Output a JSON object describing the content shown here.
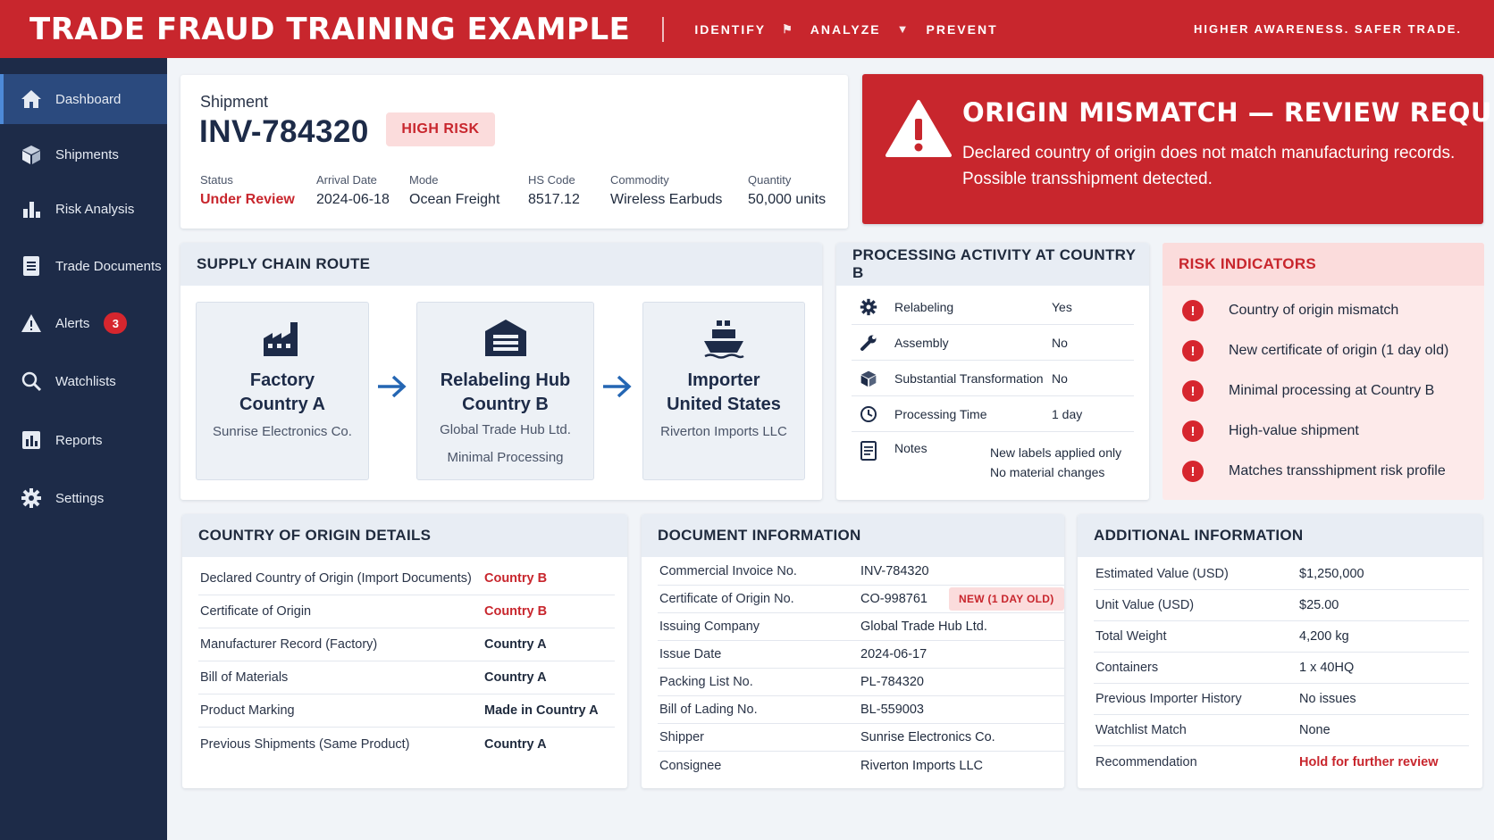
{
  "header": {
    "title": "TRADE FRAUD TRAINING EXAMPLE",
    "steps": [
      "IDENTIFY",
      "ANALYZE",
      "PREVENT"
    ],
    "tagline": "HIGHER AWARENESS. SAFER TRADE."
  },
  "sidebar": {
    "items": [
      {
        "label": "Dashboard",
        "icon": "home-icon",
        "active": true
      },
      {
        "label": "Shipments",
        "icon": "box-icon"
      },
      {
        "label": "Risk Analysis",
        "icon": "bar-chart-icon"
      },
      {
        "label": "Trade Documents",
        "icon": "document-icon"
      },
      {
        "label": "Alerts",
        "icon": "warning-icon",
        "badge": "3"
      },
      {
        "label": "Watchlists",
        "icon": "search-icon"
      },
      {
        "label": "Reports",
        "icon": "report-icon"
      },
      {
        "label": "Settings",
        "icon": "gear-icon"
      }
    ]
  },
  "shipment": {
    "label": "Shipment",
    "id": "INV-784320",
    "risk": "HIGH RISK",
    "fields": [
      {
        "key": "Status",
        "value": "Under Review"
      },
      {
        "key": "Arrival Date",
        "value": "2024-06-18"
      },
      {
        "key": "Mode",
        "value": "Ocean Freight"
      },
      {
        "key": "HS Code",
        "value": "8517.12"
      },
      {
        "key": "Commodity",
        "value": "Wireless Earbuds"
      },
      {
        "key": "Quantity",
        "value": "50,000 units"
      }
    ]
  },
  "alert": {
    "title": "ORIGIN MISMATCH — REVIEW REQUIRED",
    "body": "Declared country of origin does not match manufacturing records. Possible transshipment detected."
  },
  "route": {
    "title": "SUPPLY CHAIN ROUTE",
    "nodes": [
      {
        "title1": "Factory",
        "title2": "Country A",
        "sub1": "Sunrise Electronics Co.",
        "sub2": ""
      },
      {
        "title1": "Relabeling Hub",
        "title2": "Country B",
        "sub1": "Global Trade Hub Ltd.",
        "sub2": "Minimal Processing"
      },
      {
        "title1": "Importer",
        "title2": "United States",
        "sub1": "Riverton Imports LLC",
        "sub2": ""
      }
    ]
  },
  "processing": {
    "title": "PROCESSING ACTIVITY AT COUNTRY B",
    "rows": [
      {
        "icon": "gear-icon",
        "key": "Relabeling",
        "value": "Yes"
      },
      {
        "icon": "wrench-icon",
        "key": "Assembly",
        "value": "No"
      },
      {
        "icon": "cube-icon",
        "key": "Substantial Transformation",
        "value": "No"
      },
      {
        "icon": "clock-icon",
        "key": "Processing Time",
        "value": "1 day"
      },
      {
        "icon": "notes-icon",
        "key": "Notes",
        "value1": "New labels applied only",
        "value2": "No material changes"
      }
    ]
  },
  "risk_indicators": {
    "title": "RISK INDICATORS",
    "items": [
      "Country of origin mismatch",
      "New certificate of origin (1 day old)",
      "Minimal processing at Country B",
      "High-value shipment",
      "Matches transshipment risk profile"
    ]
  },
  "origin": {
    "title": "COUNTRY OF ORIGIN DETAILS",
    "rows": [
      {
        "key": "Declared Country of Origin (Import Documents)",
        "value": "Country B"
      },
      {
        "key": "Certificate of Origin",
        "value": "Country B"
      },
      {
        "key": "Manufacturer Record (Factory)",
        "value": "Country A"
      },
      {
        "key": "Bill of Materials",
        "value": "Country A"
      },
      {
        "key": "Product Marking",
        "value": "Made in Country A"
      },
      {
        "key": "Previous Shipments (Same Product)",
        "value": "Country A"
      }
    ]
  },
  "documents": {
    "title": "DOCUMENT INFORMATION",
    "new_badge": "NEW (1 DAY OLD)",
    "rows": [
      {
        "key": "Commercial Invoice No.",
        "value": "INV-784320"
      },
      {
        "key": "Certificate of Origin No.",
        "value": "CO-998761"
      },
      {
        "key": "Issuing Company",
        "value": "Global Trade Hub Ltd."
      },
      {
        "key": "Issue Date",
        "value": "2024-06-17"
      },
      {
        "key": "Packing List No.",
        "value": "PL-784320"
      },
      {
        "key": "Bill of Lading No.",
        "value": "BL-559003"
      },
      {
        "key": "Shipper",
        "value": "Sunrise Electronics Co."
      },
      {
        "key": "Consignee",
        "value": "Riverton Imports LLC"
      }
    ]
  },
  "additional": {
    "title": "ADDITIONAL INFORMATION",
    "rows": [
      {
        "key": "Estimated Value (USD)",
        "value": "$1,250,000"
      },
      {
        "key": "Unit Value (USD)",
        "value": "$25.00"
      },
      {
        "key": "Total Weight",
        "value": "4,200 kg"
      },
      {
        "key": "Containers",
        "value": "1 x 40HQ"
      },
      {
        "key": "Previous Importer History",
        "value": "No issues"
      },
      {
        "key": "Watchlist Match",
        "value": "None"
      },
      {
        "key": "Recommendation",
        "value": "Hold for further review"
      }
    ]
  },
  "colors": {
    "brand_red": "#c8262d",
    "navy": "#1d2b48",
    "accent_blue": "#2b4a7e"
  }
}
